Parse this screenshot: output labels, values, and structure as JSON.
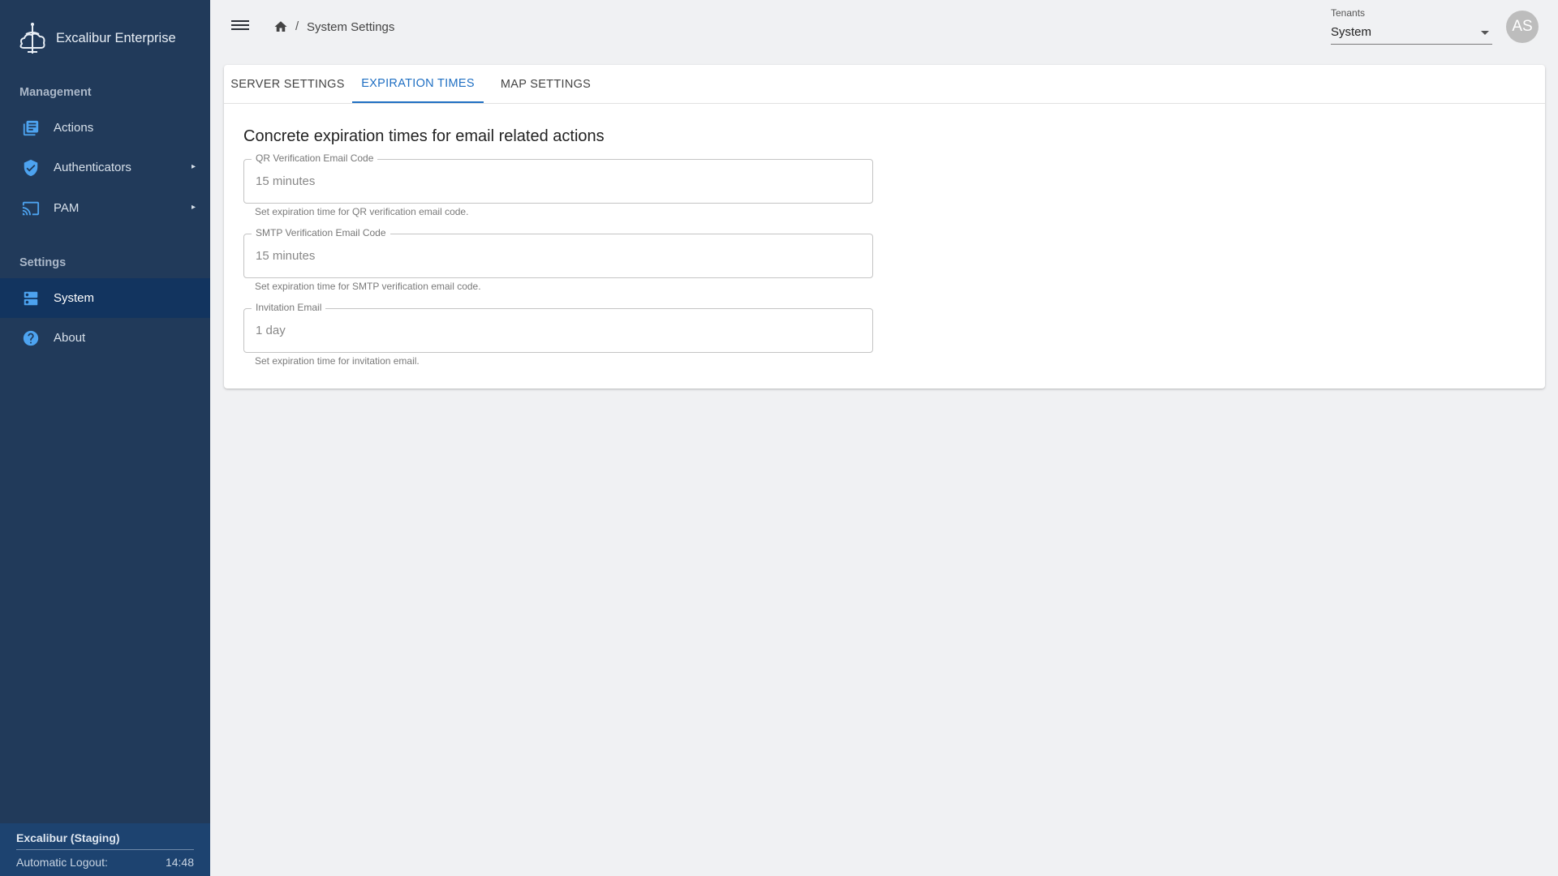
{
  "app": {
    "name": "Excalibur Enterprise"
  },
  "sidebar": {
    "management_title": "Management",
    "management_items": [
      {
        "label": "Actions",
        "icon": "list-icon"
      },
      {
        "label": "Authenticators",
        "icon": "shield-check-icon",
        "expandable": true
      },
      {
        "label": "PAM",
        "icon": "cast-icon",
        "expandable": true
      }
    ],
    "settings_title": "Settings",
    "settings_items": [
      {
        "label": "System",
        "icon": "server-icon",
        "active": true
      },
      {
        "label": "About",
        "icon": "help-circle-icon"
      }
    ],
    "footer": {
      "environment": "Excalibur (Staging)",
      "logout_label": "Automatic Logout:",
      "logout_time": "14:48"
    }
  },
  "topbar": {
    "breadcrumb": {
      "separator": "/",
      "current": "System Settings"
    },
    "tenants": {
      "label": "Tenants",
      "value": "System"
    },
    "avatar_initials": "AS"
  },
  "tabs": [
    {
      "label": "SERVER SETTINGS",
      "active": false
    },
    {
      "label": "EXPIRATION TIMES",
      "active": true
    },
    {
      "label": "MAP SETTINGS",
      "active": false
    }
  ],
  "content": {
    "heading": "Concrete expiration times for email related actions",
    "fields": [
      {
        "label": "QR Verification Email Code",
        "value": "15 minutes",
        "help": "Set expiration time for QR verification email code."
      },
      {
        "label": "SMTP Verification Email Code",
        "value": "15 minutes",
        "help": "Set expiration time for SMTP verification email code."
      },
      {
        "label": "Invitation Email",
        "value": "1 day",
        "help": "Set expiration time for invitation email."
      }
    ]
  },
  "colors": {
    "sidebar_bg": "#213a5a",
    "sidebar_active": "#12345f",
    "accent": "#1f6fc3",
    "icon_blue": "#4da3f0"
  }
}
